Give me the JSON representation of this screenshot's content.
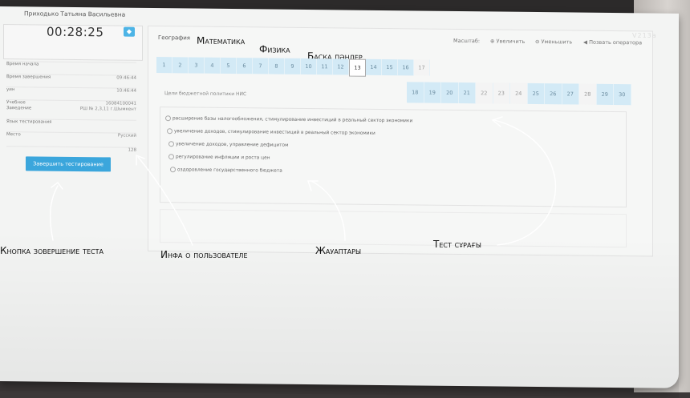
{
  "monitor_model": "V213a",
  "user": {
    "name": "Приходько Татьяна Васильевна",
    "timer": "00:28:25",
    "info": [
      {
        "label": "Время начала",
        "value": ""
      },
      {
        "label": "Время завершения",
        "value": "09:46:44"
      },
      {
        "label": "уин",
        "value": "10:46:44"
      },
      {
        "label": "Учебное",
        "value": "16084100041"
      },
      {
        "label": "Заведение",
        "value": "РШ № 2,3,11 г.Шымкент"
      },
      {
        "label": "Язык тестирования",
        "value": ""
      },
      {
        "label": "Место",
        "value": "Русский"
      },
      {
        "label": "",
        "value": "128"
      }
    ],
    "finish_button": "Завершить тестирование"
  },
  "tabs": {
    "geo": "География",
    "math": "Математика",
    "phys": "Физика",
    "other": "Басқа пәндер"
  },
  "toolbar": {
    "scale": "Масштаб:",
    "zoom_in": "Увеличить",
    "zoom_out": "Уменьшить",
    "call_operator": "Позвать оператора"
  },
  "questions_row1": [
    "1",
    "2",
    "3",
    "4",
    "5",
    "6",
    "7",
    "8",
    "9",
    "10",
    "11",
    "12",
    "13",
    "14",
    "15",
    "16",
    "17"
  ],
  "questions_row2": [
    "18",
    "19",
    "20",
    "21",
    "22",
    "23",
    "24",
    "25",
    "26",
    "27",
    "28",
    "29",
    "30"
  ],
  "current_question": "13",
  "question_text": "Цели бюджетной политики НИС",
  "answers": [
    "расширение базы налогообложения, стимулирование инвестиций в реальный сектор экономики",
    "увеличение доходов, стимулирование инвестиций в реальный сектор экономики",
    "увеличение доходов, управление дефицитом",
    "регулирование инфляции и роста цен",
    "оздоровление государственного бюджета"
  ],
  "annotations": {
    "finish": "Кнопка зовершение теста",
    "user_info": "Инфа о пользователе",
    "answers": "Жауаптары",
    "question": "Тест сұрағы"
  }
}
